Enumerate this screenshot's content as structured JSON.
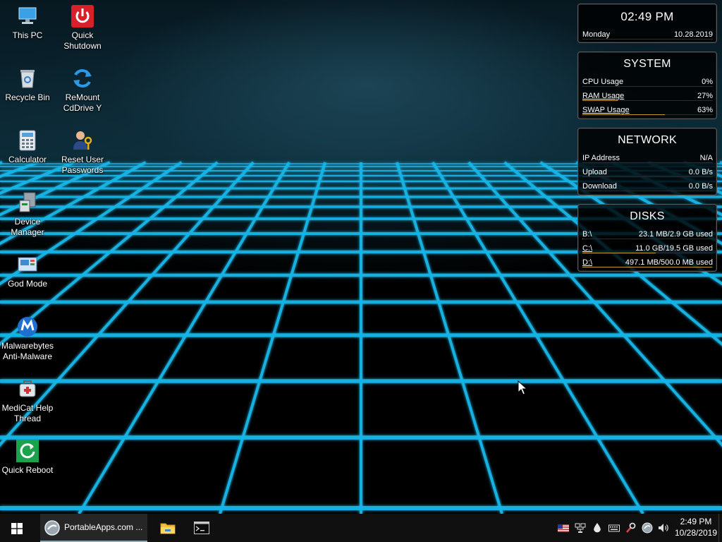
{
  "desktop": {
    "icons": [
      {
        "label": "This PC",
        "icon": "computer-icon"
      },
      {
        "label": "Quick Shutdown",
        "icon": "power-icon"
      },
      {
        "label": "Recycle Bin",
        "icon": "recycle-bin-icon"
      },
      {
        "label": "ReMount CdDrive Y",
        "icon": "refresh-icon"
      },
      {
        "label": "Calculator",
        "icon": "calculator-icon"
      },
      {
        "label": "Reset User Passwords",
        "icon": "user-key-icon"
      },
      {
        "label": "Device Manager",
        "icon": "device-manager-icon"
      },
      {
        "label": "God Mode",
        "icon": "control-panel-icon"
      },
      {
        "label": "Malwarebytes Anti-Malware",
        "icon": "malwarebytes-icon"
      },
      {
        "label": "MediCat Help Thread",
        "icon": "medicat-icon"
      },
      {
        "label": "Quick Reboot",
        "icon": "reboot-icon"
      }
    ]
  },
  "widgets": {
    "clock": {
      "time": "02:49 PM",
      "day": "Monday",
      "date": "10.28.2019"
    },
    "system": {
      "title": "SYSTEM",
      "rows": [
        {
          "label": "CPU Usage",
          "value": "0%",
          "fraction": 0.0
        },
        {
          "label": "RAM Usage",
          "value": "27%",
          "fraction": 0.27
        },
        {
          "label": "SWAP Usage",
          "value": "63%",
          "fraction": 0.63
        }
      ]
    },
    "network": {
      "title": "NETWORK",
      "rows": [
        {
          "label": "IP Address",
          "value": "N/A"
        },
        {
          "label": "Upload",
          "value": "0.0 B/s"
        },
        {
          "label": "Download",
          "value": "0.0 B/s"
        }
      ]
    },
    "disks": {
      "title": "DISKS",
      "rows": [
        {
          "label": "B:\\",
          "value": "23.1 MB/2.9 GB used",
          "fraction": 0.008
        },
        {
          "label": "C:\\",
          "value": "11.0 GB/19.5 GB used",
          "fraction": 0.564
        },
        {
          "label": "D:\\",
          "value": "497.1 MB/500.0 MB used",
          "fraction": 0.994
        }
      ]
    }
  },
  "taskbar": {
    "start_icon": "windows-logo-icon",
    "apps": [
      {
        "label": "PortableApps.com ...",
        "icon": "portableapps-icon",
        "active": true
      },
      {
        "label": "",
        "icon": "file-explorer-icon",
        "active": false
      },
      {
        "label": "",
        "icon": "command-prompt-icon",
        "active": false
      }
    ],
    "tray_icons": [
      "us-flag-icon",
      "network-icon",
      "drop-icon",
      "keyboard-icon",
      "tool-icon",
      "portableapps-tray-icon",
      "volume-icon"
    ],
    "clock": {
      "time": "2:49 PM",
      "date": "10/28/2019"
    }
  },
  "colors": {
    "grid": "#19b4e6",
    "widget_bar": "#c89a2c",
    "taskbar": "#101010"
  }
}
